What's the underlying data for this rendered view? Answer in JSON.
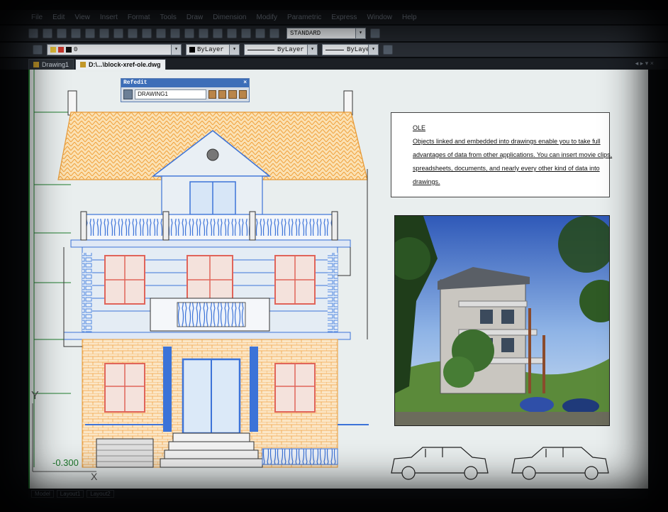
{
  "menu": {
    "items": [
      "File",
      "Edit",
      "View",
      "Insert",
      "Format",
      "Tools",
      "Draw",
      "Dimension",
      "Modify",
      "Parametric",
      "Express",
      "Window",
      "Help"
    ]
  },
  "toolbar": {
    "text_style": "STANDARD",
    "layer": "0",
    "color": "ByLayer",
    "linetype": "ByLayer",
    "lineweight": "ByLayer"
  },
  "tabs": [
    {
      "label": "Drawing1",
      "active": false
    },
    {
      "label": "D:\\...\\block-xref-ole.dwg",
      "active": true
    }
  ],
  "tab_controls": "◂ ▸ ▾ ×",
  "refedit": {
    "title": "Refedit",
    "close": "×",
    "reference": "DRAWING1"
  },
  "ole": {
    "heading": "OLE",
    "lines": [
      "Objects linked and embedded into drawings enable you to take full",
      "advantages of data from other applications. You can insert movie clips,",
      "spreadsheets, documents, and nearly every other kind of data into",
      "drawings."
    ]
  },
  "elevation_label": "-0.300",
  "axis": {
    "y": "Y",
    "x": "X"
  },
  "command_tabs": [
    "Model",
    "Layout1",
    "Layout2"
  ],
  "colors": {
    "roof": "#f3a94b",
    "facade_blue": "#3c73d8",
    "window_red": "#e0645a",
    "canvas": "#e9eeee",
    "accent_tab": "#3d6eb8"
  }
}
